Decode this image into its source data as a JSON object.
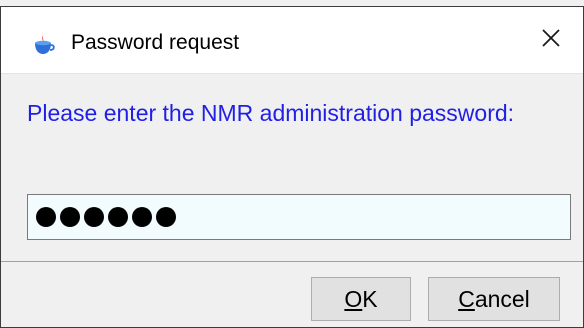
{
  "window": {
    "title": "Password request",
    "close_glyph": "✕",
    "app_icon": "java-cup-icon"
  },
  "prompt": {
    "text": "Please enter the NMR administration password:",
    "color": "#1f1fe6"
  },
  "password": {
    "masked_length": 6,
    "background": "#f2fcff"
  },
  "buttons": {
    "ok": {
      "mnemonic": "O",
      "rest": "K"
    },
    "cancel": {
      "mnemonic": "C",
      "rest": "ancel"
    }
  }
}
